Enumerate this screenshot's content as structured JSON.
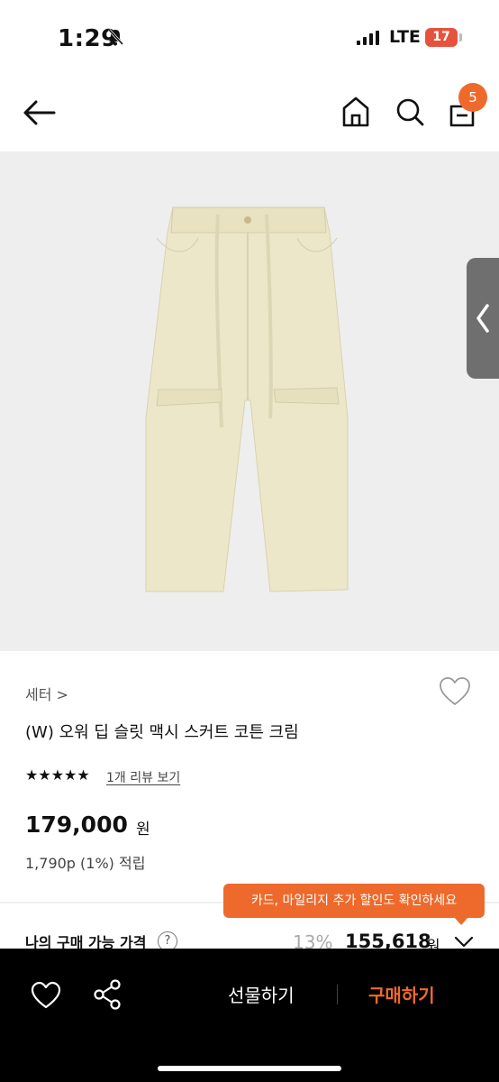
{
  "status_bar": {
    "time": "1:29",
    "network": "LTE",
    "battery": "17"
  },
  "header": {
    "cart_count": "5"
  },
  "product": {
    "brand": "세터 >",
    "title": "(W) 오워 딥 슬릿 맥시 스커트 코튼 크림",
    "stars": "★★★★★",
    "review_link": "1개 리뷰 보기",
    "price": "179,000",
    "price_unit": "원",
    "points": "1,790p (1%) 적립"
  },
  "tooltip": {
    "text": "카드, 마일리지 추가 할인도 확인하세요"
  },
  "my_price": {
    "label": "나의 구매 가능 가격",
    "help": "?",
    "discount": "13%",
    "price": "155,618",
    "unit": "원"
  },
  "bottom_bar": {
    "gift_label": "선물하기",
    "buy_label": "구매하기"
  },
  "colors": {
    "accent": "#ee6a2c",
    "bottom_bar": "#000000",
    "image_bg": "#eeeeee"
  }
}
